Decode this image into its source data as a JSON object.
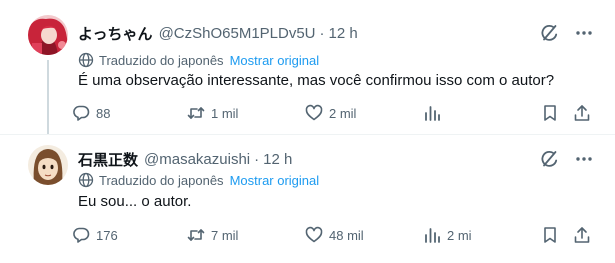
{
  "tweets": [
    {
      "name": "よっちゃん",
      "handle": "@CzShO65M1PLDv5U",
      "separator": "·",
      "time": "12 h",
      "translated_label": "Traduzido do japonês",
      "show_original": "Mostrar original",
      "text": "É uma observação interessante, mas você confirmou isso com o autor?",
      "replies": "88",
      "retweets": "1 mil",
      "likes": "2 mil",
      "views": "",
      "avatar": "anime-character-red-hair"
    },
    {
      "name": "石黒正数",
      "handle": "@masakazuishi",
      "separator": "·",
      "time": "12 h",
      "translated_label": "Traduzido do japonês",
      "show_original": "Mostrar original",
      "text": "Eu sou... o autor.",
      "replies": "176",
      "retweets": "7 mil",
      "likes": "48 mil",
      "views": "2 mi",
      "avatar": "cartoon-character-brown-hair"
    }
  ],
  "icons": {
    "grok": "grok-icon",
    "more": "more-icon",
    "globe": "globe-icon",
    "reply": "reply-icon",
    "retweet": "retweet-icon",
    "like": "like-icon",
    "views": "views-icon",
    "bookmark": "bookmark-icon",
    "share": "share-icon"
  },
  "colors": {
    "text": "#0f1419",
    "secondary": "#536471",
    "link": "#1d9bf0",
    "thread_line": "#cfd9de"
  }
}
